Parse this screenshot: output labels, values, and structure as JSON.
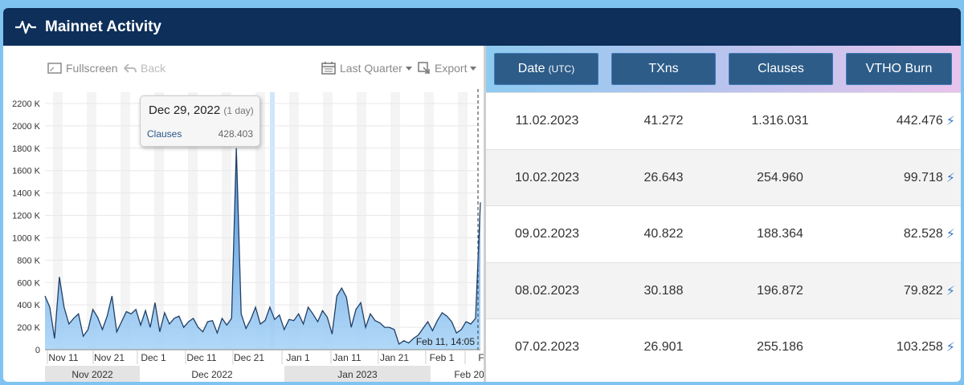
{
  "header": {
    "title": "Mainnet Activity",
    "icon": "pulse-icon"
  },
  "toolbar": {
    "fullscreen_label": "Fullscreen",
    "back_label": "Back",
    "period_label": "Last Quarter",
    "export_label": "Export"
  },
  "tooltip": {
    "date": "Dec 29, 2022",
    "span": "(1 day)",
    "series": "Clauses",
    "value": "428.403"
  },
  "chart_data": {
    "type": "area",
    "series": [
      {
        "name": "Clauses",
        "color": "#4a90d9"
      }
    ],
    "y_ticks": [
      "0",
      "200 K",
      "400 K",
      "600 K",
      "800 K",
      "1000 K",
      "1200 K",
      "1400 K",
      "1600 K",
      "1800 K",
      "2000 K",
      "2200 K"
    ],
    "ylim": [
      0,
      2300000
    ],
    "x_ticks": [
      "Nov 11",
      "Nov 21",
      "Dec 1",
      "Dec 11",
      "Dec 21",
      "Jan 1",
      "Jan 11",
      "Jan 21",
      "Feb 1",
      "F"
    ],
    "months": [
      "Nov 2022",
      "Dec 2022",
      "Jan 2023",
      "Feb 20"
    ],
    "crosshair_label": "Feb 11, 14:05",
    "values": [
      480000,
      380000,
      100000,
      650000,
      380000,
      230000,
      280000,
      320000,
      120000,
      180000,
      360000,
      290000,
      180000,
      300000,
      480000,
      160000,
      250000,
      340000,
      320000,
      360000,
      220000,
      350000,
      200000,
      420000,
      160000,
      330000,
      230000,
      280000,
      300000,
      200000,
      250000,
      280000,
      200000,
      160000,
      250000,
      260000,
      150000,
      280000,
      220000,
      280000,
      1800000,
      320000,
      190000,
      270000,
      380000,
      230000,
      260000,
      380000,
      270000,
      310000,
      180000,
      270000,
      260000,
      320000,
      230000,
      380000,
      320000,
      250000,
      350000,
      290000,
      140000,
      480000,
      550000,
      470000,
      200000,
      360000,
      420000,
      200000,
      320000,
      260000,
      240000,
      200000,
      200000,
      180000,
      50000,
      80000,
      60000,
      100000,
      130000,
      190000,
      250000,
      170000,
      260000,
      330000,
      300000,
      250000,
      150000,
      180000,
      250000,
      230000,
      280000,
      1316031
    ]
  },
  "table": {
    "headers": {
      "date": "Date",
      "date_unit": "(UTC)",
      "txns": "TXns",
      "clauses": "Clauses",
      "vtho": "VTHO Burn"
    },
    "rows": [
      {
        "date": "11.02.2023",
        "txns": "41.272",
        "clauses": "1.316.031",
        "vtho": "442.476"
      },
      {
        "date": "10.02.2023",
        "txns": "26.643",
        "clauses": "254.960",
        "vtho": "99.718"
      },
      {
        "date": "09.02.2023",
        "txns": "40.822",
        "clauses": "188.364",
        "vtho": "82.528"
      },
      {
        "date": "08.02.2023",
        "txns": "30.188",
        "clauses": "196.872",
        "vtho": "79.822"
      },
      {
        "date": "07.02.2023",
        "txns": "26.901",
        "clauses": "255.186",
        "vtho": "103.258"
      }
    ],
    "bolt_icon": "lightning-icon"
  }
}
